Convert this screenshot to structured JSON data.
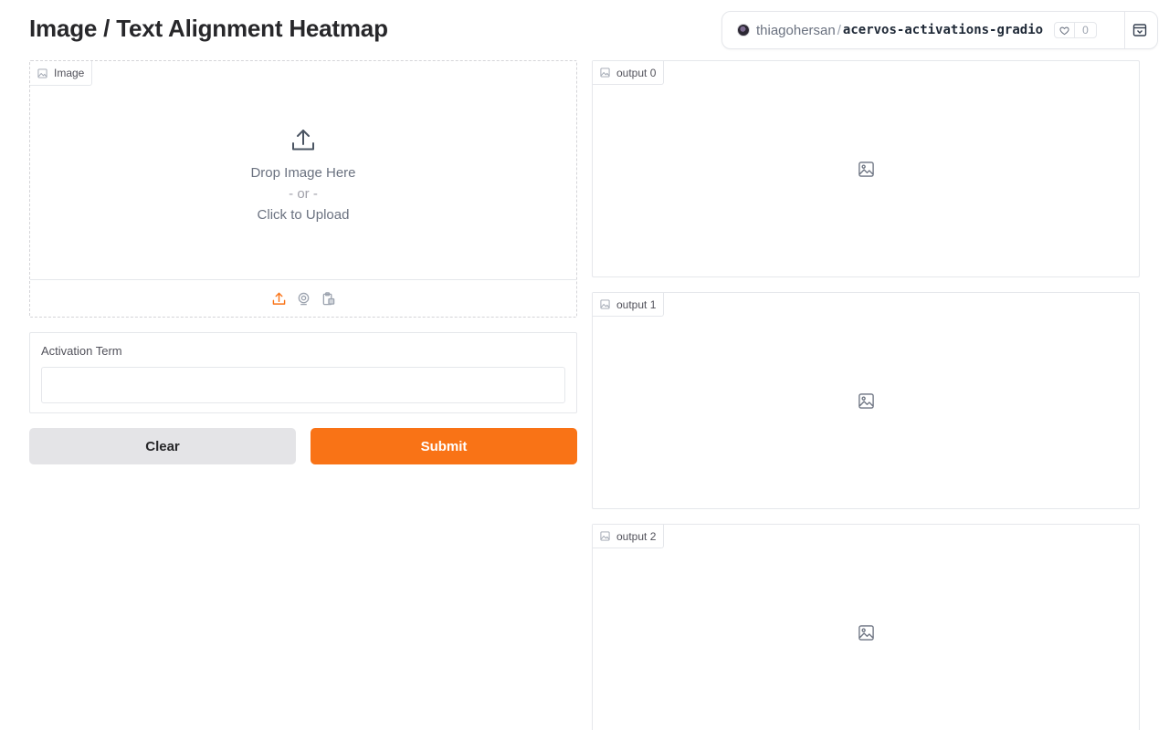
{
  "page": {
    "title": "Image / Text Alignment Heatmap"
  },
  "space": {
    "owner": "thiagohersan",
    "separator": "/",
    "repo": "acervos-activations-gradio",
    "likes": "0"
  },
  "image_input": {
    "label": "Image",
    "drop_text": "Drop Image Here",
    "or_text": "- or -",
    "click_text": "Click to Upload",
    "sources": [
      "upload-icon",
      "webcam-icon",
      "clipboard-icon"
    ]
  },
  "term": {
    "label": "Activation Term",
    "value": ""
  },
  "buttons": {
    "clear": "Clear",
    "submit": "Submit"
  },
  "outputs": [
    {
      "label": "output 0"
    },
    {
      "label": "output 1"
    },
    {
      "label": "output 2"
    }
  ],
  "colors": {
    "accent": "#f97316",
    "clear_bg": "#e4e4e7",
    "border": "#e5e7eb",
    "text": "#27272a",
    "muted": "#6b7280"
  }
}
